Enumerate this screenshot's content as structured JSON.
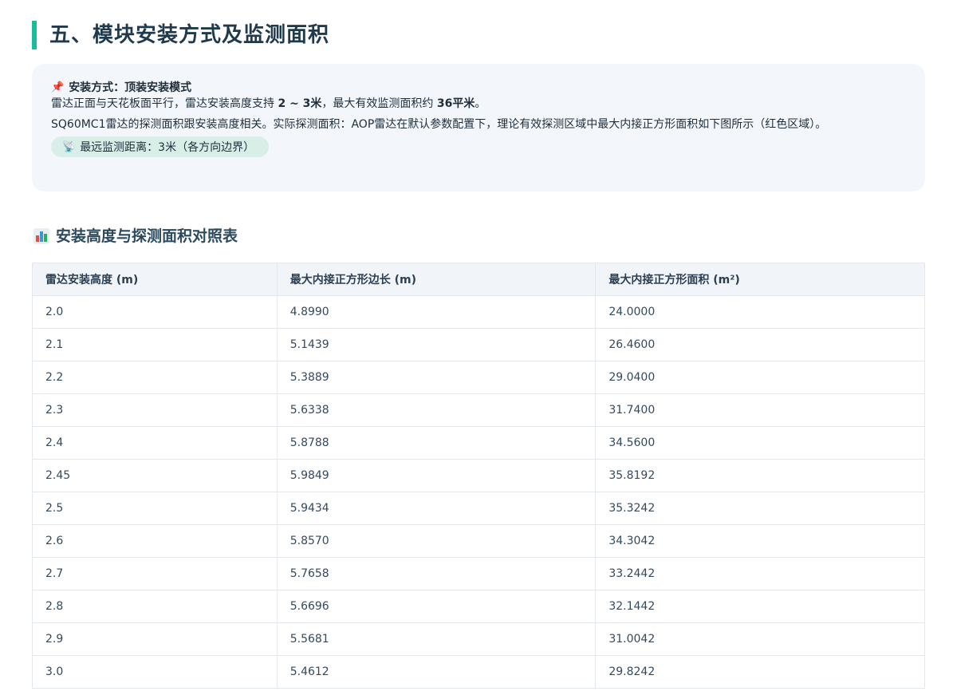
{
  "section_title": "五、模块安装方式及监测面积",
  "info": {
    "head_label": "安装方式：顶装安装模式",
    "line1_a": "雷达正面与天花板面平行，雷达安装高度支持 ",
    "line1_b": "2 ~ 3米",
    "line1_c": "，最大有效监测面积约 ",
    "line1_d": "36平米",
    "line1_e": "。",
    "paragraph": "SQ60MC1雷达的探测面积跟安装高度相关。实际探测面积：AOP雷达在默认参数配置下，理论有效探测区域中最大内接正方形面积如下图所示（红色区域）。",
    "range_chip": "最远监测距离：3米（各方向边界）"
  },
  "table_title": "安装高度与探测面积对照表",
  "table": {
    "headers": [
      "雷达安装高度 (m)",
      "最大内接正方形边长 (m)",
      "最大内接正方形面积 (m²)"
    ],
    "rows": [
      [
        "2.0",
        "4.8990",
        "24.0000"
      ],
      [
        "2.1",
        "5.1439",
        "26.4600"
      ],
      [
        "2.2",
        "5.3889",
        "29.0400"
      ],
      [
        "2.3",
        "5.6338",
        "31.7400"
      ],
      [
        "2.4",
        "5.8788",
        "34.5600"
      ],
      [
        "2.45",
        "5.9849",
        "35.8192"
      ],
      [
        "2.5",
        "5.9434",
        "35.3242"
      ],
      [
        "2.6",
        "5.8570",
        "34.3042"
      ],
      [
        "2.7",
        "5.7658",
        "33.2442"
      ],
      [
        "2.8",
        "5.6696",
        "32.1442"
      ],
      [
        "2.9",
        "5.5681",
        "31.0042"
      ],
      [
        "3.0",
        "5.4612",
        "29.8242"
      ]
    ]
  },
  "icons": {
    "pin": "pushpin-icon",
    "satellite": "satellite-icon",
    "chart": "bar-chart-icon"
  },
  "colors": {
    "accent": "#1abc9c",
    "info_bg": "#f3f7fb",
    "chip_bg": "#d8efe8"
  }
}
